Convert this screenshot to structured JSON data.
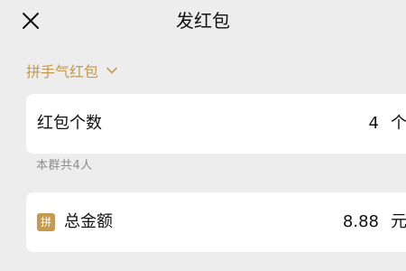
{
  "header": {
    "title": "发红包",
    "close_icon": "close-icon"
  },
  "type_switch": {
    "label": "拼手气红包",
    "icon": "chevron-down-icon",
    "color": "#c39a4f"
  },
  "count_row": {
    "label": "红包个数",
    "value": "4",
    "unit": "个"
  },
  "group_note": "本群共4人",
  "amount_row": {
    "badge": "拼",
    "label": "总金额",
    "value": "8.88",
    "unit": "元"
  }
}
